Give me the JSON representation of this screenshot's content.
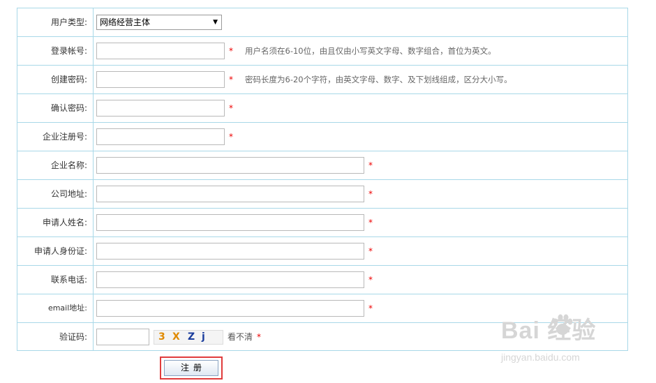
{
  "form": {
    "business_type": {
      "label": "用户类型:",
      "selected": "网络经营主体"
    },
    "username": {
      "label": "登录帐号:",
      "hint": "用户名须在6-10位，由且仅由小写英文字母、数字组合，首位为英文。"
    },
    "password": {
      "label": "创建密码:",
      "hint": "密码长度为6-20个字符，由英文字母、数字、及下划线组成，区分大小写。"
    },
    "confirm_password": {
      "label": "确认密码:"
    },
    "reg_number": {
      "label": "企业注册号:"
    },
    "company_name": {
      "label": "企业名称:"
    },
    "company_address": {
      "label": "公司地址:"
    },
    "applicant_name": {
      "label": "申请人姓名:"
    },
    "applicant_id": {
      "label": "申请人身份证:"
    },
    "phone": {
      "label": "联系电话:"
    },
    "email": {
      "label": "email地址:"
    },
    "captcha": {
      "label": "验证码:",
      "image_text": [
        "3",
        "X",
        "Z",
        "j"
      ],
      "refresh": "看不清"
    },
    "required_mark": "*",
    "submit_label": "注册"
  },
  "watermark": {
    "logo": "Bai 经验",
    "url": "jingyan.baidu.com"
  },
  "colors": {
    "border": "#a8d8e8",
    "required": "#e00000",
    "highlight": "#e03c3c"
  }
}
